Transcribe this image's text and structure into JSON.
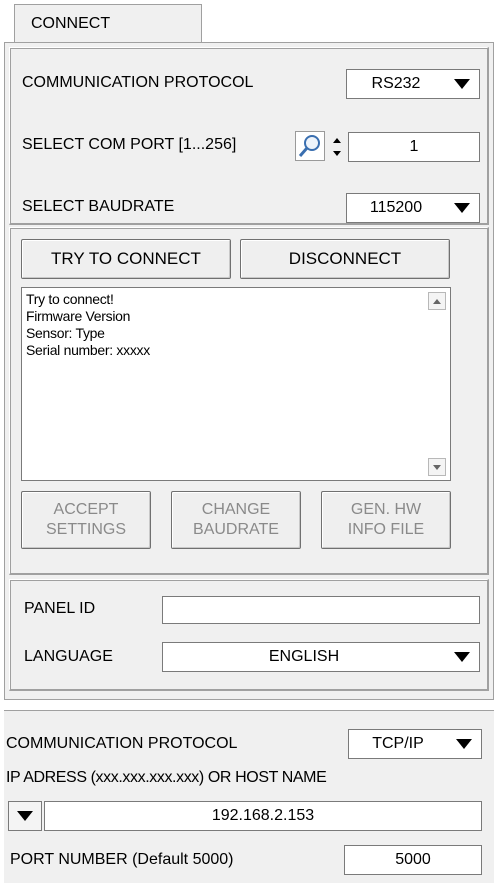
{
  "tab": {
    "label": "CONNECT"
  },
  "comm": {
    "protocol_label": "COMMUNICATION PROTOCOL",
    "protocol_value": "RS232",
    "com_port_label": "SELECT COM PORT [1...256]",
    "com_port_value": "1",
    "baudrate_label": "SELECT BAUDRATE",
    "baudrate_value": "115200"
  },
  "connect": {
    "try_label": "TRY TO CONNECT",
    "disconnect_label": "DISCONNECT",
    "log_lines": [
      "Try to connect!",
      "Firmware Version",
      "Sensor: Type",
      "Serial number: xxxxx"
    ]
  },
  "actions": {
    "accept_1": "ACCEPT",
    "accept_2": "SETTINGS",
    "change_1": "CHANGE",
    "change_2": "BAUDRATE",
    "gen_1": "GEN. HW",
    "gen_2": "INFO FILE"
  },
  "panel": {
    "panel_id_label": "PANEL ID",
    "panel_id_value": "",
    "language_label": "LANGUAGE",
    "language_value": "ENGLISH"
  },
  "tcp": {
    "protocol_label": "COMMUNICATION PROTOCOL",
    "protocol_value": "TCP/IP",
    "ip_label": "IP ADRESS (xxx.xxx.xxx.xxx) OR HOST NAME",
    "ip_value": "192.168.2.153",
    "port_label": "PORT NUMBER (Default 5000)",
    "port_value": "5000"
  },
  "colors": {
    "panel_bg": "#f0f0f0",
    "disabled_text": "#8a8a8a",
    "border": "#a0a0a0"
  }
}
